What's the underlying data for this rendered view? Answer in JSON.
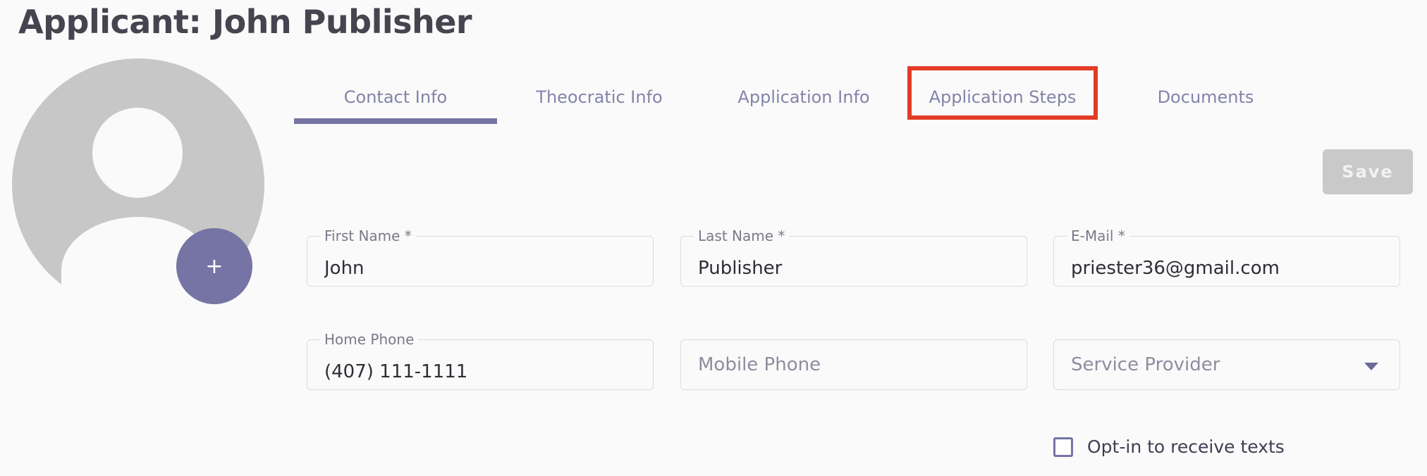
{
  "page": {
    "title": "Applicant: John Publisher"
  },
  "avatar": {
    "add_label": "+"
  },
  "tabs": [
    {
      "label": "Contact Info",
      "active": true
    },
    {
      "label": "Theocratic Info"
    },
    {
      "label": "Application Info"
    },
    {
      "label": "Application Steps",
      "highlighted": true
    },
    {
      "label": "Documents"
    }
  ],
  "actions": {
    "save_label": "Save"
  },
  "form": {
    "first_name": {
      "label": "First Name *",
      "value": "John"
    },
    "last_name": {
      "label": "Last Name *",
      "value": "Publisher"
    },
    "email": {
      "label": "E-Mail *",
      "value": "priester36@gmail.com"
    },
    "home_phone": {
      "label": "Home Phone",
      "value": "(407) 111-1111"
    },
    "mobile_phone": {
      "placeholder": "Mobile Phone"
    },
    "service_provider": {
      "placeholder": "Service Provider"
    },
    "optin": {
      "label": "Opt-in to receive texts",
      "checked": false
    }
  },
  "colors": {
    "accent": "#7574a4",
    "highlight": "#e23c25",
    "tab_text": "#8483aa"
  }
}
